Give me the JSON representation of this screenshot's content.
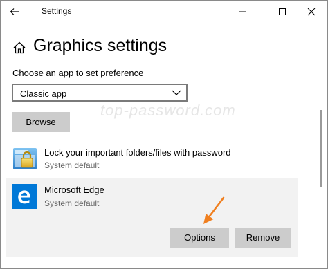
{
  "window": {
    "title": "Settings"
  },
  "header": {
    "title": "Graphics settings"
  },
  "preference": {
    "label": "Choose an app to set preference",
    "selected_option": "Classic app",
    "browse_label": "Browse"
  },
  "watermark": "top-password.com",
  "apps": [
    {
      "name": "Lock your important folders/files with password",
      "status": "System default",
      "icon": "folder-lock-icon"
    },
    {
      "name": "Microsoft Edge",
      "status": "System default",
      "icon": "edge-icon",
      "selected": true,
      "actions": {
        "options_label": "Options",
        "remove_label": "Remove"
      }
    }
  ],
  "colors": {
    "button_bg": "#cccccc",
    "selected_row_bg": "#f2f2f2",
    "edge_blue": "#0078d7",
    "arrow_orange": "#f07f1f"
  }
}
